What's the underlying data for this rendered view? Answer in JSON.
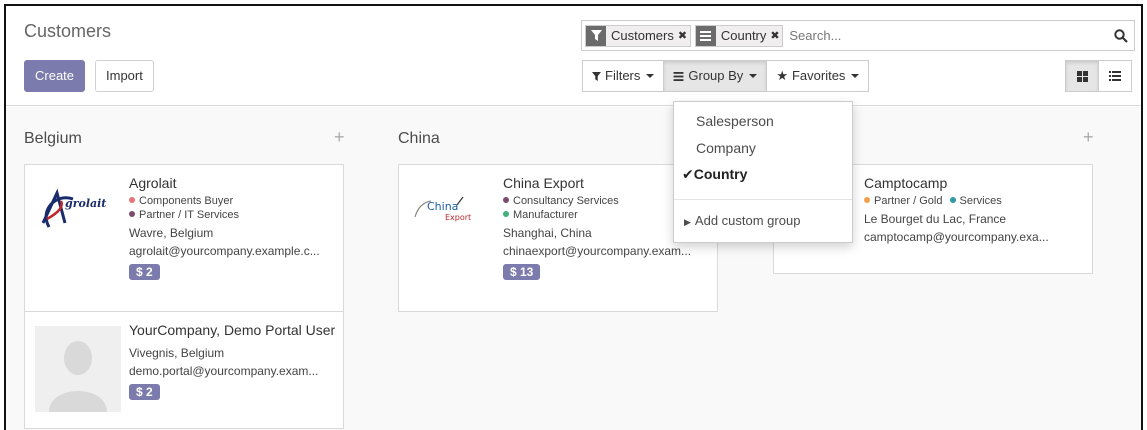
{
  "page": {
    "title": "Customers"
  },
  "buttons": {
    "create": "Create",
    "import": "Import"
  },
  "search": {
    "placeholder": "Search...",
    "facets": [
      {
        "icon": "filter-icon",
        "label": "Customers"
      },
      {
        "icon": "groupby-icon",
        "label": "Country"
      }
    ]
  },
  "toolbar": {
    "filters": "Filters",
    "group_by": "Group By",
    "favorites": "Favorites"
  },
  "view_switch": {
    "active": "kanban-view"
  },
  "groupby_menu": {
    "items": [
      {
        "label": "Salesperson",
        "selected": false
      },
      {
        "label": "Company",
        "selected": false
      },
      {
        "label": "Country",
        "selected": true
      }
    ],
    "custom": "Add custom group"
  },
  "columns": [
    {
      "title": "Belgium",
      "cards": [
        {
          "name": "Agrolait",
          "logo_text": "grolait",
          "tags": [
            {
              "label": "Components Buyer",
              "color": "#e8737a"
            },
            {
              "label": "Partner / IT Services",
              "color": "#7b4b6e"
            }
          ],
          "location": "Wavre, Belgium",
          "email": "agrolait@yourcompany.example.c...",
          "badge": "$ 2"
        },
        {
          "name": "YourCompany, Demo Portal User",
          "tags": [],
          "location": "Vivegnis, Belgium",
          "email": "demo.portal@yourcompany.exam...",
          "badge": "$ 2"
        }
      ]
    },
    {
      "title": "China",
      "cards": [
        {
          "name": "China Export",
          "logo_text": "China",
          "logo_subtext": "Export",
          "tags": [
            {
              "label": "Consultancy Services",
              "color": "#7b4b6e"
            },
            {
              "label": "Manufacturer",
              "color": "#3fb07a"
            }
          ],
          "location": "Shanghai, China",
          "email": "chinaexport@yourcompany.exam...",
          "badge": "$ 13"
        }
      ]
    },
    {
      "title": "",
      "cards": [
        {
          "name": "Camptocamp",
          "tags": [
            {
              "label": "Partner / Gold",
              "color": "#f0a04b"
            },
            {
              "label": "Services",
              "color": "#2e9aa0"
            }
          ],
          "location": "Le Bourget du Lac, France",
          "email": "camptocamp@yourcompany.exa...",
          "badge": ""
        }
      ]
    }
  ]
}
